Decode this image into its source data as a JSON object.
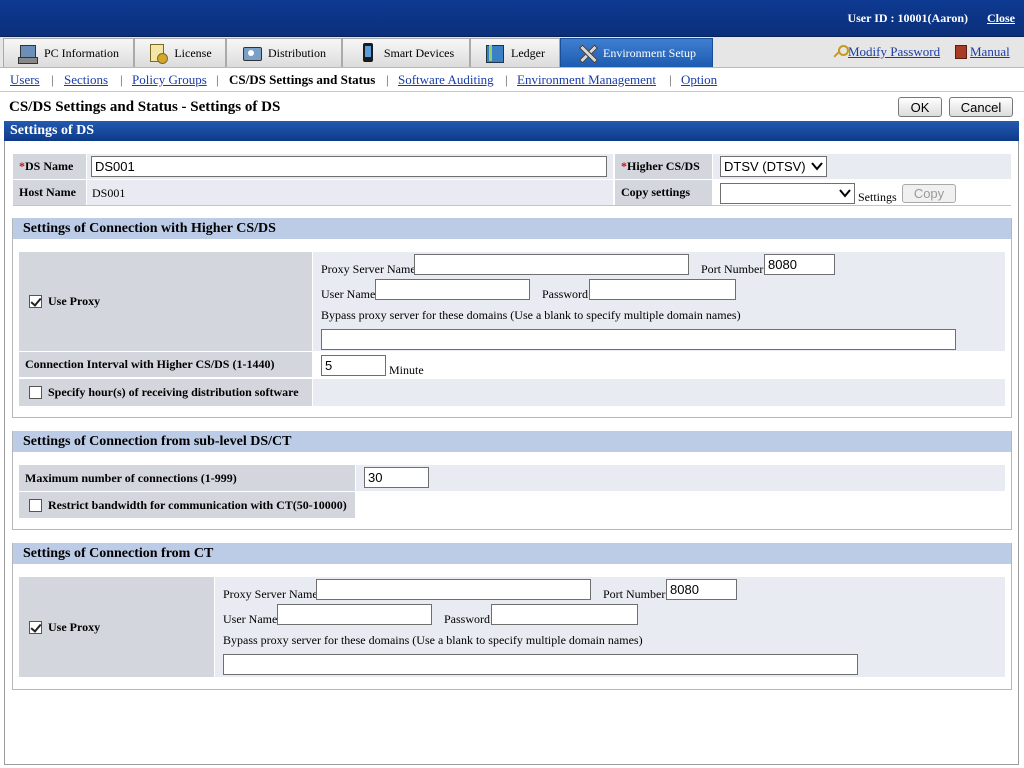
{
  "header": {
    "user_id": "User ID : 10001(Aaron)",
    "close_link": "Close"
  },
  "tabs": [
    {
      "label": "PC Information",
      "icon": "pc-icon"
    },
    {
      "label": "License",
      "icon": "license-icon"
    },
    {
      "label": "Distribution",
      "icon": "distribution-icon"
    },
    {
      "label": "Smart Devices",
      "icon": "phone-icon"
    },
    {
      "label": "Ledger",
      "icon": "ledger-icon"
    },
    {
      "label": "Environment Setup",
      "icon": "tools-icon",
      "active": true
    }
  ],
  "top_links": {
    "modify_password": "Modify Password",
    "manual": "Manual"
  },
  "subnav": [
    {
      "label": "Users"
    },
    {
      "label": "Sections"
    },
    {
      "label": "Policy Groups"
    },
    {
      "label": "CS/DS Settings and Status",
      "current": true
    },
    {
      "label": "Software Auditing"
    },
    {
      "label": "Environment Management"
    },
    {
      "label": "Option"
    }
  ],
  "page": {
    "title": "CS/DS Settings and Status - Settings of DS",
    "ok_label": "OK",
    "cancel_label": "Cancel",
    "section_title": "Settings of DS"
  },
  "ds": {
    "required_mark": "*",
    "ds_name_label": "DS Name",
    "ds_name_value": "DS001",
    "higher_label": "Higher CS/DS",
    "higher_value": "DTSV (DTSV)",
    "host_name_label": "Host Name",
    "host_name_value": "DS001",
    "copy_settings_label": "Copy settings",
    "copy_settings_value": "",
    "settings_text": "Settings",
    "copy_button": "Copy"
  },
  "higher_conn": {
    "title": "Settings of Connection with Higher CS/DS",
    "use_proxy_label": "Use Proxy",
    "use_proxy_checked": true,
    "proxy_server_label": "Proxy Server Name",
    "proxy_server_value": "",
    "port_label": "Port Number",
    "port_value": "8080",
    "user_name_label": "User Name",
    "user_name_value": "",
    "password_label": "Password",
    "password_value": "",
    "bypass_label": "Bypass proxy server for these domains (Use a blank to specify multiple domain names)",
    "bypass_value": "",
    "interval_label": "Connection Interval with Higher CS/DS (1-1440)",
    "interval_value": "5",
    "interval_unit": "Minute",
    "specify_hours_label": "Specify hour(s) of receiving distribution software",
    "specify_hours_checked": false
  },
  "sub_conn": {
    "title": "Settings of Connection from sub-level DS/CT",
    "max_conn_label": "Maximum number of connections (1-999)",
    "max_conn_value": "30",
    "restrict_label": "Restrict bandwidth for communication with CT(50-10000)",
    "restrict_checked": false
  },
  "ct_conn": {
    "title": "Settings of Connection from CT",
    "use_proxy_label": "Use Proxy",
    "use_proxy_checked": true,
    "proxy_server_label": "Proxy Server Name",
    "proxy_server_value": "",
    "port_label": "Port Number",
    "port_value": "8080",
    "user_name_label": "User Name",
    "user_name_value": "",
    "password_label": "Password",
    "password_value": "",
    "bypass_label": "Bypass proxy server for these domains (Use a blank to specify multiple domain names)",
    "bypass_value": ""
  }
}
